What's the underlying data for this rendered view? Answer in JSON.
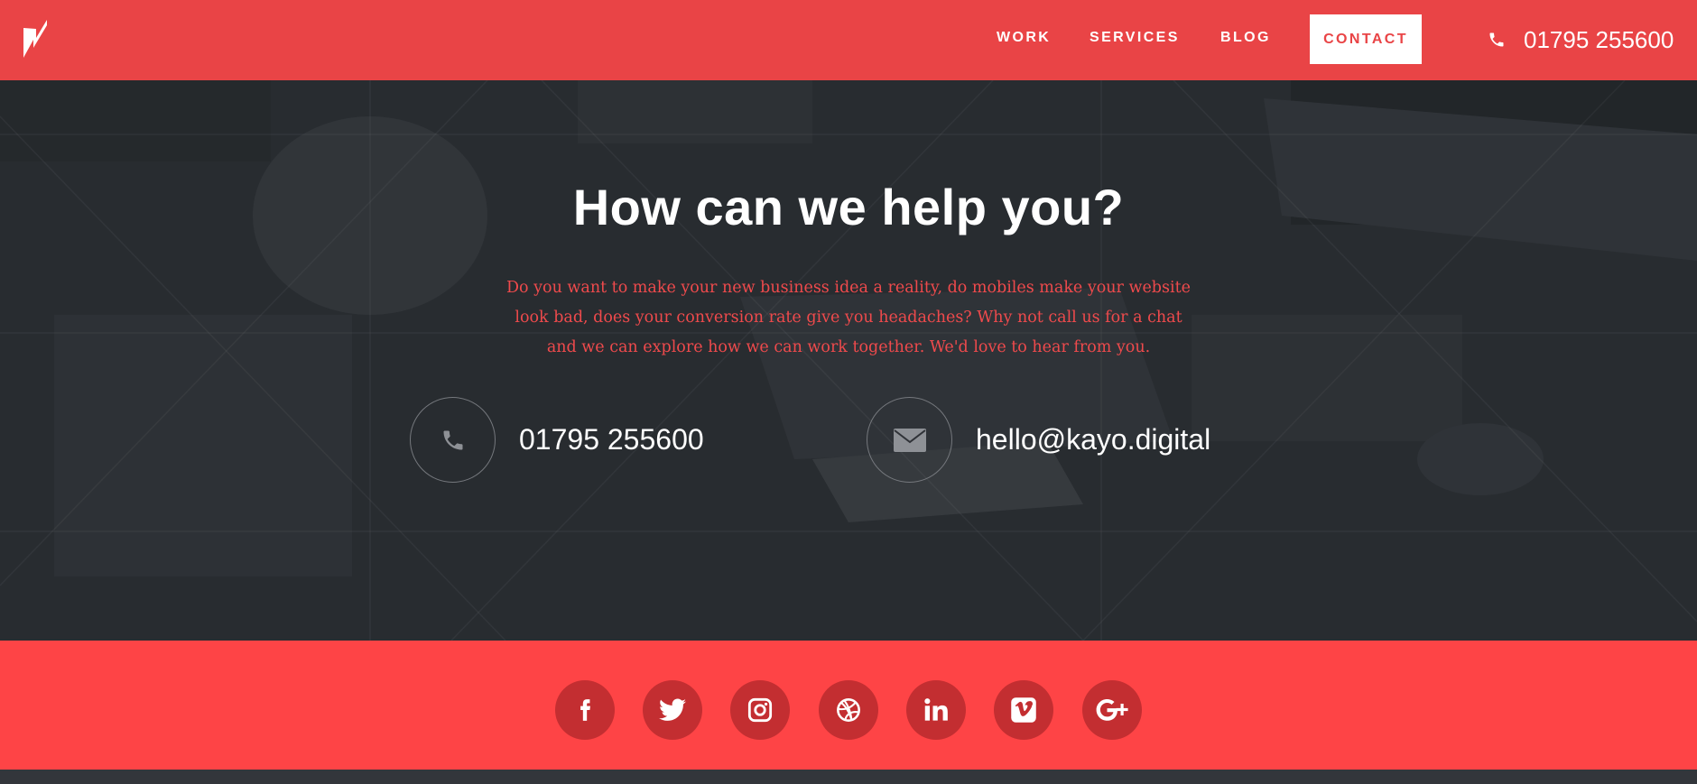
{
  "header": {
    "logo_icon": "lightning-slash-logo",
    "nav": [
      {
        "label": "WORK"
      },
      {
        "label": "SERVICES"
      },
      {
        "label": "BLOG"
      },
      {
        "label": "CONTACT"
      }
    ],
    "phone": "01795 255600",
    "phone_icon": "phone-icon"
  },
  "hero": {
    "title": "How can we help you?",
    "text": "Do you want to make your new business idea a reality, do mobiles make your website look bad, does your conversion rate give you headaches? Why not call us for a chat and we can explore how we can work together. We'd love to hear from you.",
    "phone": "01795 255600",
    "email": "hello@kayo.digital"
  },
  "social": [
    {
      "icon": "facebook-icon"
    },
    {
      "icon": "twitter-icon"
    },
    {
      "icon": "instagram-icon"
    },
    {
      "icon": "dribbble-icon"
    },
    {
      "icon": "linkedin-icon"
    },
    {
      "icon": "vimeo-icon"
    },
    {
      "icon": "google-plus-icon"
    }
  ],
  "colors": {
    "header": "#e94446",
    "accent": "#fe4446",
    "social_circle": "#c32e31",
    "hero_bg": "#2e3136",
    "hero_text": "#ef4a4c"
  }
}
